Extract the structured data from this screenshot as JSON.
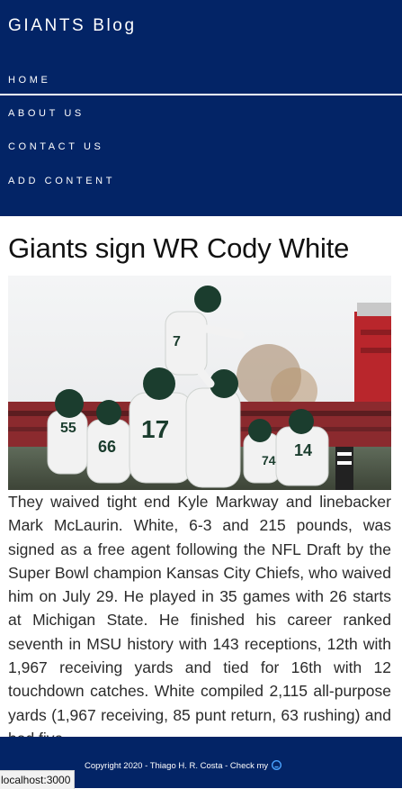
{
  "brand": {
    "title": "GIANTS Blog"
  },
  "nav": {
    "home": "HOME",
    "about": "ABOUT US",
    "contact": "CONTACT US",
    "add": "ADD CONTENT"
  },
  "article": {
    "title": "Giants sign WR Cody White",
    "image_alt": "Michigan State players lifting a teammate in celebration",
    "body": "They waived tight end Kyle Markway and linebacker Mark McLaurin. White, 6-3 and 215 pounds, was signed as a free agent following the NFL Draft by the Super Bowl champion Kansas City Chiefs, who waived him on July 29. He played in 35 games with 26 starts at Michigan State. He finished his career ranked seventh in MSU history with 143 receptions, 12th with 1,967 receiving yards and tied for 16th with 12 touchdown catches. White compiled 2,115 all-purpose yards (1,967 receiving, 85 punt return, 63 rushing) and had five"
  },
  "footer": {
    "copyright": "Copyright 2020 - Thiago H. R. Costa - Check my",
    "icon": "github-icon"
  },
  "status_bar": {
    "url": "localhost:3000"
  },
  "colors": {
    "header_bg": "#032466",
    "footer_bg": "#032466",
    "text": "#2b2b2b"
  }
}
